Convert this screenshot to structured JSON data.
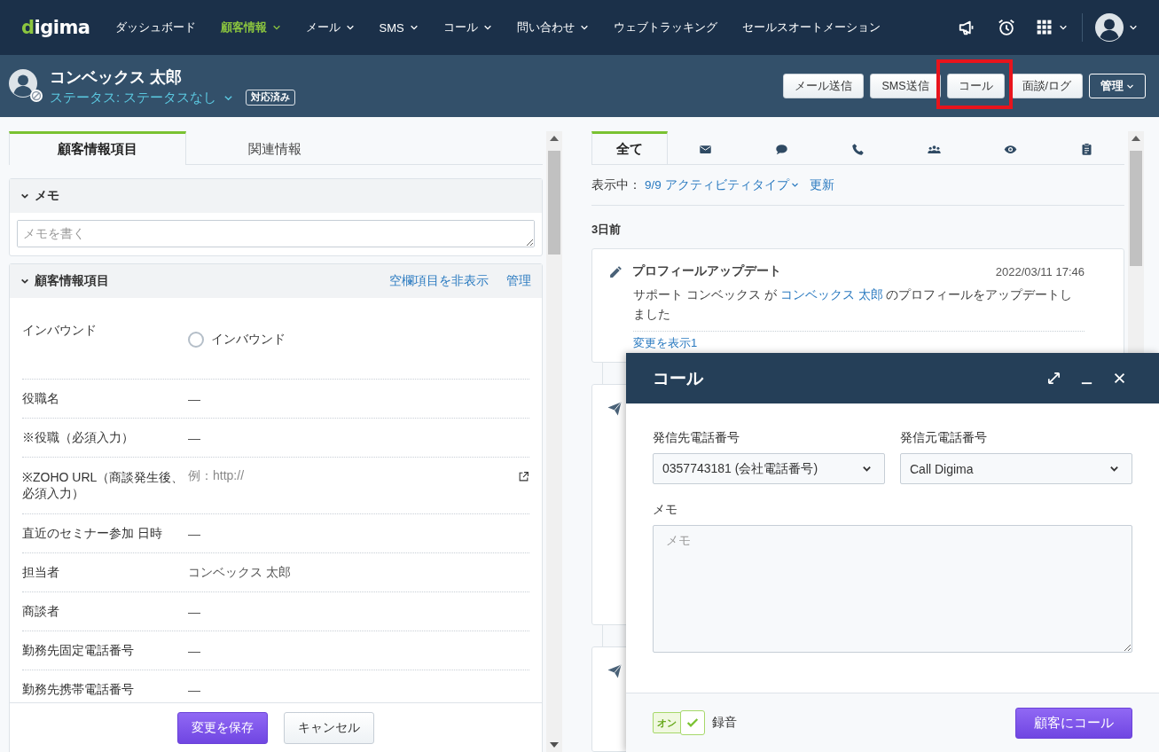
{
  "nav": {
    "logo": "digima",
    "items": [
      {
        "label": "ダッシュボード",
        "selected": false,
        "dropdown": false
      },
      {
        "label": "顧客情報",
        "selected": true,
        "dropdown": true
      },
      {
        "label": "メール",
        "selected": false,
        "dropdown": true
      },
      {
        "label": "SMS",
        "selected": false,
        "dropdown": true
      },
      {
        "label": "コール",
        "selected": false,
        "dropdown": true
      },
      {
        "label": "問い合わせ",
        "selected": false,
        "dropdown": true
      },
      {
        "label": "ウェブトラッキング",
        "selected": false,
        "dropdown": false
      },
      {
        "label": "セールスオートメーション",
        "selected": false,
        "dropdown": false
      }
    ]
  },
  "header": {
    "name": "コンベックス 太郎",
    "status": "ステータス: ステータスなし",
    "badge": "対応済み",
    "actions": [
      {
        "label": "メール送信",
        "kind": "plain",
        "highlighted": false
      },
      {
        "label": "SMS送信",
        "kind": "plain",
        "highlighted": false
      },
      {
        "label": "コール",
        "kind": "plain",
        "highlighted": true
      },
      {
        "label": "面談/ログ",
        "kind": "plain",
        "highlighted": false
      },
      {
        "label": "管理",
        "kind": "menu",
        "highlighted": false
      }
    ]
  },
  "customer": {
    "tabs": [
      {
        "label": "顧客情報項目",
        "selected": true
      },
      {
        "label": "関連情報",
        "selected": false
      }
    ],
    "memo": {
      "title": "メモ",
      "placeholder": "メモを書く"
    },
    "fields": {
      "title": "顧客情報項目",
      "links": [
        "空欄項目を非表示",
        "管理"
      ],
      "rows": [
        {
          "kind": "radio",
          "label": "インバウンド",
          "option": "インバウンド",
          "checked": false
        },
        {
          "kind": "text",
          "label": "役職名",
          "value": "—"
        },
        {
          "kind": "text",
          "label": "※役職（必須入力）",
          "value": "—"
        },
        {
          "kind": "url",
          "label": "※ZOHO URL（商談発生後、必須入力）",
          "placeholder": "例：http://"
        },
        {
          "kind": "text",
          "label": "直近のセミナー参加 日時",
          "value": "—"
        },
        {
          "kind": "text",
          "label": "担当者",
          "value": "コンベックス 太郎"
        },
        {
          "kind": "text",
          "label": "商談者",
          "value": "—"
        },
        {
          "kind": "text",
          "label": "勤務先固定電話番号",
          "value": "—"
        },
        {
          "kind": "text",
          "label": "勤務先携帯電話番号",
          "value": "—"
        }
      ]
    },
    "buttons": [
      {
        "label": "変更を保存",
        "kind": "primary"
      },
      {
        "label": "キャンセル",
        "kind": "secondary"
      }
    ]
  },
  "activity": {
    "tabs": [
      {
        "kind": "text",
        "label": "全て",
        "selected": true
      },
      {
        "kind": "mail",
        "selected": false
      },
      {
        "kind": "chat",
        "selected": false
      },
      {
        "kind": "phone",
        "selected": false
      },
      {
        "kind": "group",
        "selected": false
      },
      {
        "kind": "eye",
        "selected": false
      },
      {
        "kind": "clipboard",
        "selected": false
      }
    ],
    "filter": {
      "prefix": "表示中：",
      "value": "9/9 アクティビティタイプ",
      "refresh": "更新"
    },
    "day": "3日前",
    "entry": {
      "title": "プロフィールアップデート",
      "time": "2022/03/11 17:46",
      "text_before": "サポート コンベックス が ",
      "link": "コンベックス 太郎",
      "text_after": " のプロフィールをアップデートしました",
      "changes": "変更を表示1"
    }
  },
  "dialog": {
    "title": "コール",
    "to": {
      "label": "発信先電話番号",
      "value": "0357743181 (会社電話番号)"
    },
    "from": {
      "label": "発信元電話番号",
      "value": "Call Digima"
    },
    "memo": {
      "label": "メモ",
      "placeholder": "メモ"
    },
    "record": {
      "state_label": "オン",
      "label": "録音",
      "checked": true
    },
    "submit": "顧客にコール"
  }
}
